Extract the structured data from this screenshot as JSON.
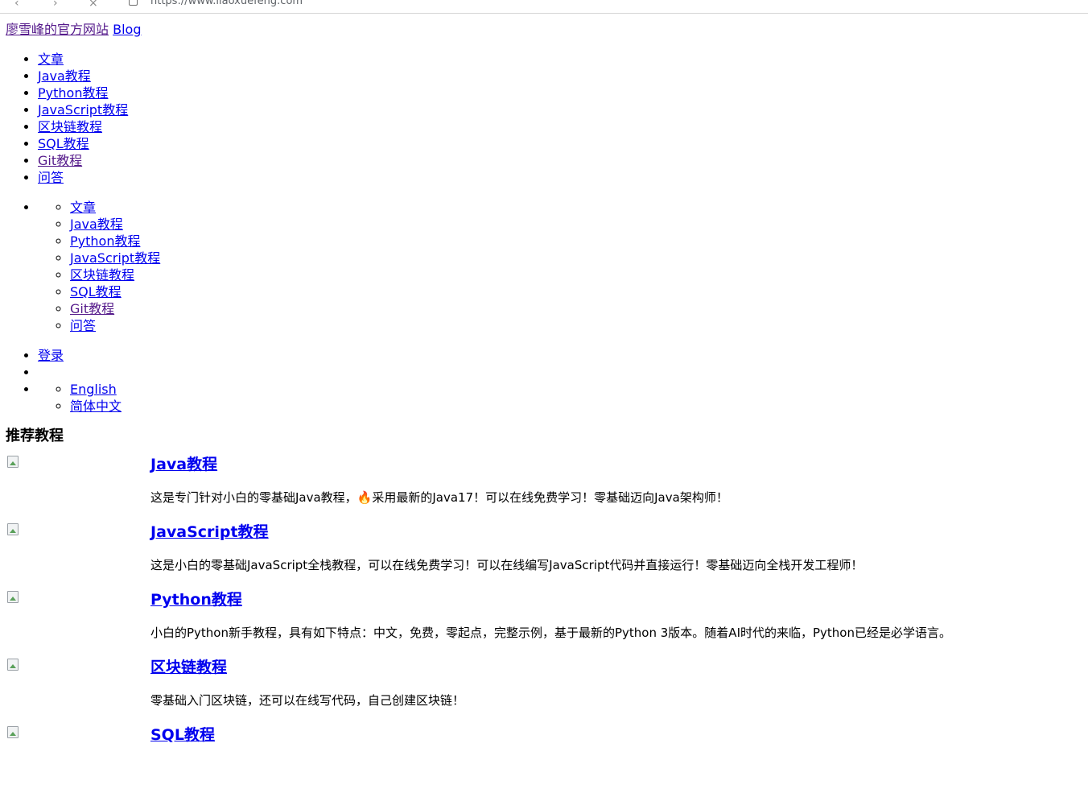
{
  "browser": {
    "url": "https://www.liaoxuefeng.com"
  },
  "header": {
    "site_link": "廖雪峰的官方网站",
    "blog_link": "Blog"
  },
  "nav_main": [
    {
      "label": "文章",
      "visited": false
    },
    {
      "label": "Java教程",
      "visited": false
    },
    {
      "label": "Python教程",
      "visited": false
    },
    {
      "label": "JavaScript教程",
      "visited": false
    },
    {
      "label": "区块链教程",
      "visited": false
    },
    {
      "label": "SQL教程",
      "visited": false
    },
    {
      "label": "Git教程",
      "visited": true
    },
    {
      "label": "问答",
      "visited": false
    }
  ],
  "nav_sub": [
    {
      "label": "文章",
      "visited": false
    },
    {
      "label": "Java教程",
      "visited": false
    },
    {
      "label": "Python教程",
      "visited": false
    },
    {
      "label": "JavaScript教程",
      "visited": false
    },
    {
      "label": "区块链教程",
      "visited": false
    },
    {
      "label": "SQL教程",
      "visited": false
    },
    {
      "label": "Git教程",
      "visited": true
    },
    {
      "label": "问答",
      "visited": false
    }
  ],
  "user_menu": {
    "login": "登录",
    "languages": [
      "English",
      "简体中文"
    ]
  },
  "recommended": {
    "heading": "推荐教程",
    "courses": [
      {
        "title": "Java教程",
        "desc": "这是专门针对小白的零基础Java教程，🔥采用最新的Java17！可以在线免费学习！零基础迈向Java架构师！"
      },
      {
        "title": "JavaScript教程",
        "desc": "这是小白的零基础JavaScript全栈教程，可以在线免费学习！可以在线编写JavaScript代码并直接运行！零基础迈向全栈开发工程师！"
      },
      {
        "title": "Python教程",
        "desc": "小白的Python新手教程，具有如下特点：中文，免费，零起点，完整示例，基于最新的Python 3版本。随着AI时代的来临，Python已经是必学语言。"
      },
      {
        "title": "区块链教程",
        "desc": "零基础入门区块链，还可以在线写代码，自己创建区块链！"
      },
      {
        "title": "SQL教程",
        "desc": ""
      }
    ]
  }
}
